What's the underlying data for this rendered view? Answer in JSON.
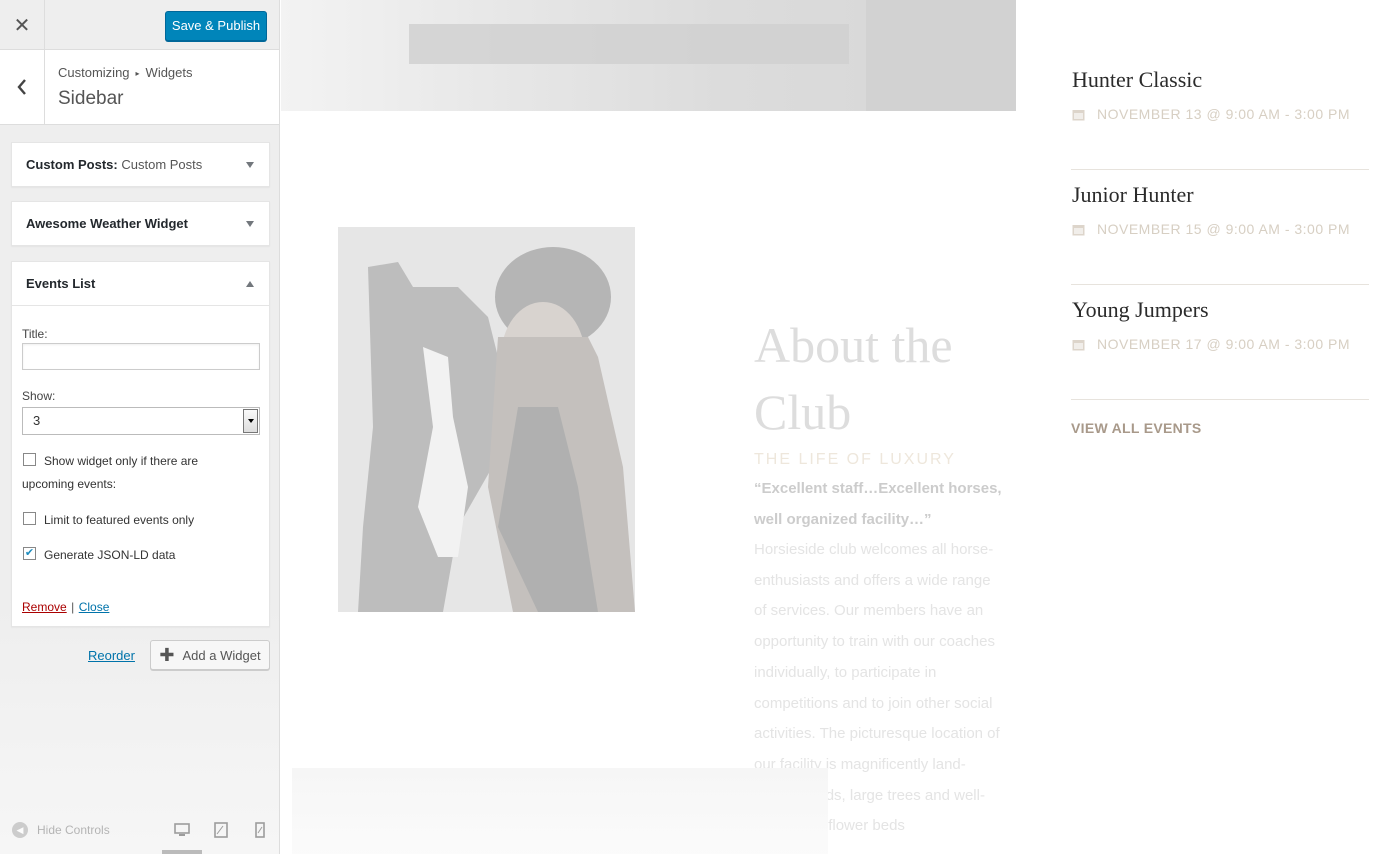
{
  "customizer": {
    "publish_label": "Save & Publish",
    "breadcrumb": {
      "root": "Customizing",
      "section": "Widgets"
    },
    "panel_title": "Sidebar",
    "widgets": [
      {
        "title": "Custom Posts",
        "subtitle": "Custom Posts",
        "expanded": false
      },
      {
        "title": "Awesome Weather Widget",
        "subtitle": "",
        "expanded": false
      },
      {
        "title": "Events List",
        "subtitle": "",
        "expanded": true
      }
    ],
    "events_form": {
      "title_label": "Title:",
      "title_value": "",
      "show_label": "Show:",
      "show_value": "3",
      "checkboxes": [
        {
          "label": "Show widget only if there are upcoming events:",
          "checked": false
        },
        {
          "label": "Limit to featured events only",
          "checked": false
        },
        {
          "label": "Generate JSON-LD data",
          "checked": true
        }
      ],
      "remove_label": "Remove",
      "separator": "|",
      "close_label": "Close"
    },
    "reorder_label": "Reorder",
    "add_widget_label": "Add a Widget",
    "hide_controls_label": "Hide Controls",
    "devices": [
      "desktop-icon",
      "tablet-icon",
      "mobile-icon"
    ]
  },
  "preview": {
    "about": {
      "title": "About the Club",
      "subtitle": "THE LIFE OF LUXURY",
      "quote": "“Excellent staff…Excellent horses, well organized facility…”",
      "body": "Horsieside club welcomes all horse-enthusiasts and offers a wide range of services. Our members have an opportunity to train with our coaches individually, to participate in competitions and to join other social activities. The picturesque location of our facility is magnificently land-scaped fields, large trees and well-manicured flower beds"
    },
    "events": [
      {
        "title": "Hunter Classic",
        "date": "NOVEMBER 13 @ 9:00 AM - 3:00 PM"
      },
      {
        "title": "Junior Hunter",
        "date": "NOVEMBER 15 @ 9:00 AM - 3:00 PM"
      },
      {
        "title": "Young Jumpers",
        "date": "NOVEMBER 17 @ 9:00 AM - 3:00 PM"
      }
    ],
    "view_all_label": "VIEW ALL EVENTS"
  },
  "colors": {
    "publish_blue": "#0085ba",
    "link_blue": "#0073aa",
    "remove_red": "#aa0000",
    "event_date": "#d7cfc3",
    "view_all": "#a8998a"
  }
}
